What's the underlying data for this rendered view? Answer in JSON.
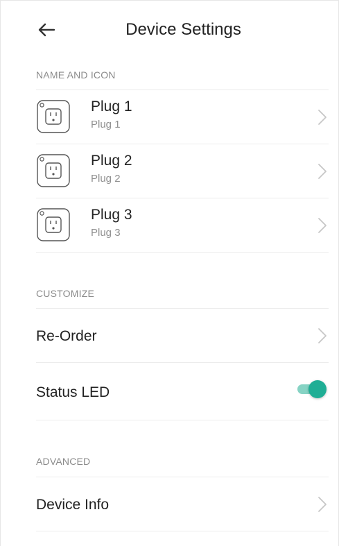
{
  "header": {
    "title": "Device Settings",
    "back_icon": "arrow-left-icon"
  },
  "sections": {
    "name_and_icon": "NAME AND ICON",
    "customize": "CUSTOMIZE",
    "advanced": "ADVANCED"
  },
  "plugs": [
    {
      "name": "Plug 1",
      "subtitle": "Plug 1",
      "icon": "outlet-icon"
    },
    {
      "name": "Plug 2",
      "subtitle": "Plug 2",
      "icon": "outlet-icon"
    },
    {
      "name": "Plug 3",
      "subtitle": "Plug 3",
      "icon": "outlet-icon"
    }
  ],
  "customize": {
    "reorder_label": "Re-Order",
    "status_led_label": "Status LED",
    "status_led_on": true
  },
  "advanced": {
    "device_info_label": "Device Info"
  },
  "colors": {
    "accent": "#1fae95",
    "accent_track": "#86d3c4",
    "divider": "#ececec",
    "secondary_text": "#8a8a8a"
  }
}
